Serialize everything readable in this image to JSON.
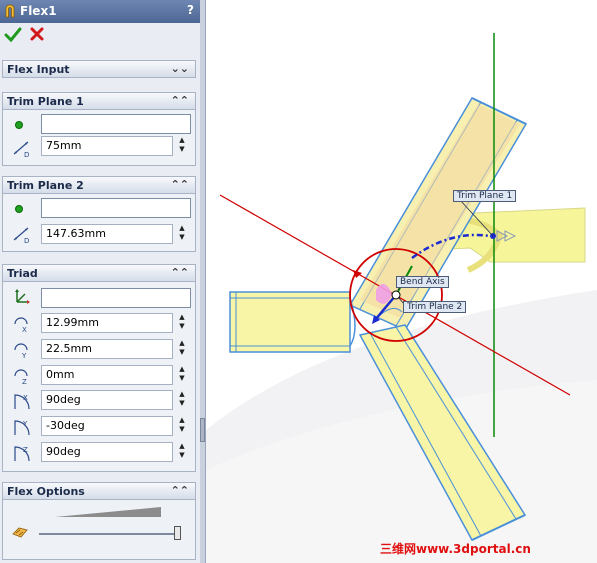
{
  "window": {
    "title": "Flex1",
    "help_label": "?",
    "ok_icon": "green-checkmark-icon",
    "cancel_icon": "red-x-icon"
  },
  "groups": {
    "flex_input": {
      "label": "Flex Input",
      "state": "collapsed"
    },
    "trim_plane_1": {
      "label": "Trim Plane 1",
      "entity_value": "",
      "distance_value": "75mm"
    },
    "trim_plane_2": {
      "label": "Trim Plane 2",
      "entity_value": "",
      "distance_value": "147.63mm"
    },
    "triad": {
      "label": "Triad",
      "reference_value": "",
      "x_value": "12.99mm",
      "y_value": "22.5mm",
      "z_value": "0mm",
      "rot_x_value": "90deg",
      "rot_y_value": "-30deg",
      "rot_z_value": "90deg"
    },
    "flex_options": {
      "label": "Flex Options",
      "slider_level": 1.0
    }
  },
  "viewport": {
    "annotations": {
      "trim_plane_1": "Trim Plane 1",
      "bend_axis": "Bend Axis",
      "trim_plane_2": "Trim Plane 2"
    },
    "watermark": "三维网www.3dportal.cn"
  },
  "colors": {
    "panel_bg": "#e9edf3",
    "title_bar": "#5a73a0",
    "accent_red": "#d00000",
    "accent_green": "#1a8a1a",
    "part_yellow": "#f6f59a"
  }
}
